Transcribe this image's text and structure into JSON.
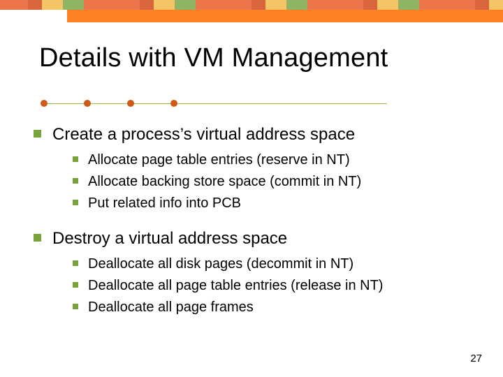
{
  "title": "Details with VM Management",
  "sections": [
    {
      "heading": "Create a process’s virtual address space",
      "items": [
        "Allocate page table entries (reserve in NT)",
        "Allocate backing store space (commit in NT)",
        "Put related info into PCB"
      ]
    },
    {
      "heading": "Destroy a virtual address space",
      "items": [
        "Deallocate all disk pages (decommit in NT)",
        "Deallocate all page table entries (release in NT)",
        "Deallocate all page frames"
      ]
    }
  ],
  "page_number": "27"
}
